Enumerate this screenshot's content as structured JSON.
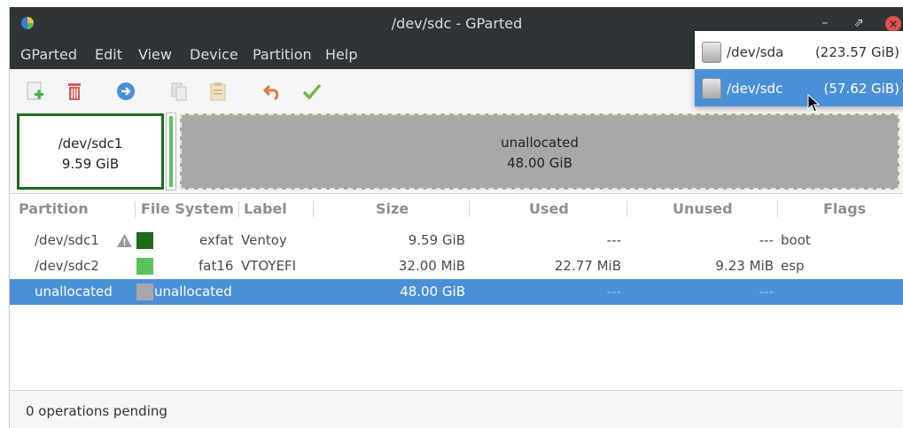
{
  "window": {
    "title": "/dev/sdc - GParted"
  },
  "menubar": {
    "items": [
      "GParted",
      "Edit",
      "View",
      "Device",
      "Partition",
      "Help"
    ]
  },
  "toolbar": {
    "buttons": [
      {
        "name": "new",
        "icon": "add-partition-icon",
        "color": "#3db34a"
      },
      {
        "name": "delete",
        "icon": "trash-icon",
        "color": "#d45c5c"
      },
      {
        "name": "resize-move",
        "icon": "arrow-right-circle-icon",
        "color": "#4a90d9"
      },
      {
        "name": "copy",
        "icon": "copy-icon"
      },
      {
        "name": "paste",
        "icon": "paste-icon"
      },
      {
        "name": "undo",
        "icon": "undo-icon",
        "color": "#e07b39"
      },
      {
        "name": "apply",
        "icon": "checkmark-icon",
        "color": "#7ab648"
      }
    ]
  },
  "visual": {
    "sdc1": {
      "name": "/dev/sdc1",
      "size": "9.59 GiB"
    },
    "unallocated": {
      "name": "unallocated",
      "size": "48.00 GiB"
    }
  },
  "table": {
    "headers": [
      "Partition",
      "File System",
      "Label",
      "Size",
      "Used",
      "Unused",
      "Flags"
    ],
    "rows": [
      {
        "partition": "/dev/sdc1",
        "warning": true,
        "swatch": "#1e6b1e",
        "fs": "exfat",
        "label": "Ventoy",
        "size": "9.59 GiB",
        "used": "---",
        "unused": "---",
        "flags": "boot"
      },
      {
        "partition": "/dev/sdc2",
        "warning": false,
        "swatch": "#5cc25c",
        "fs": "fat16",
        "label": "VTOYEFI",
        "size": "32.00 MiB",
        "used": "22.77 MiB",
        "unused": "9.23 MiB",
        "flags": "esp"
      },
      {
        "partition": "unallocated",
        "warning": false,
        "swatch": "#a8a8a8",
        "fs": "unallocated",
        "label": "",
        "size": "48.00 GiB",
        "used": "---",
        "unused": "---",
        "flags": ""
      }
    ]
  },
  "statusbar": {
    "text": "0 operations pending"
  },
  "devices": [
    {
      "name": "/dev/sda",
      "size": "(223.57 GiB)"
    },
    {
      "name": "/dev/sdc",
      "size": "(57.62 GiB)"
    }
  ],
  "colors": {
    "selection": "#4a90d9",
    "titlebar": "#2e3436"
  }
}
